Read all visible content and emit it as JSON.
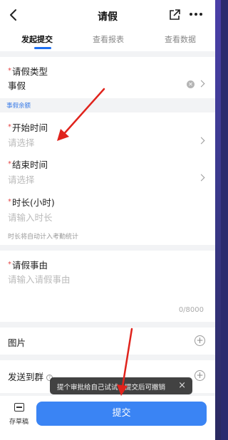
{
  "header": {
    "back_icon": "chevron-left-icon",
    "title": "请假",
    "share_icon": "external-link-icon",
    "more_icon": "more-horizontal-icon"
  },
  "tabs": [
    {
      "label": "发起提交",
      "active": true
    },
    {
      "label": "查看报表",
      "active": false
    },
    {
      "label": "查看数据",
      "active": false
    }
  ],
  "form": {
    "leave_type": {
      "label": "请假类型",
      "required": true,
      "value": "事假"
    },
    "leave_balance_link": "事假余额",
    "start_time": {
      "label": "开始时间",
      "required": true,
      "placeholder": "请选择"
    },
    "end_time": {
      "label": "结束时间",
      "required": true,
      "placeholder": "请选择"
    },
    "duration": {
      "label": "时长(小时)",
      "required": true,
      "placeholder": "请输入时长",
      "hint": "时长将自动计入考勤统计"
    },
    "reason": {
      "label": "请假事由",
      "required": true,
      "placeholder": "请输入请假事由",
      "counter": "0/8000"
    },
    "images": {
      "label": "图片"
    },
    "send_to_group": {
      "label": "发送到群"
    }
  },
  "toast": {
    "text": "提个审批给自己试试，提交后可撤销"
  },
  "bottom_bar": {
    "draft_label": "存草稿",
    "submit_label": "提交"
  },
  "colors": {
    "accent": "#3a84f4",
    "required": "#e54545",
    "annotation_arrow": "#e0231c"
  }
}
